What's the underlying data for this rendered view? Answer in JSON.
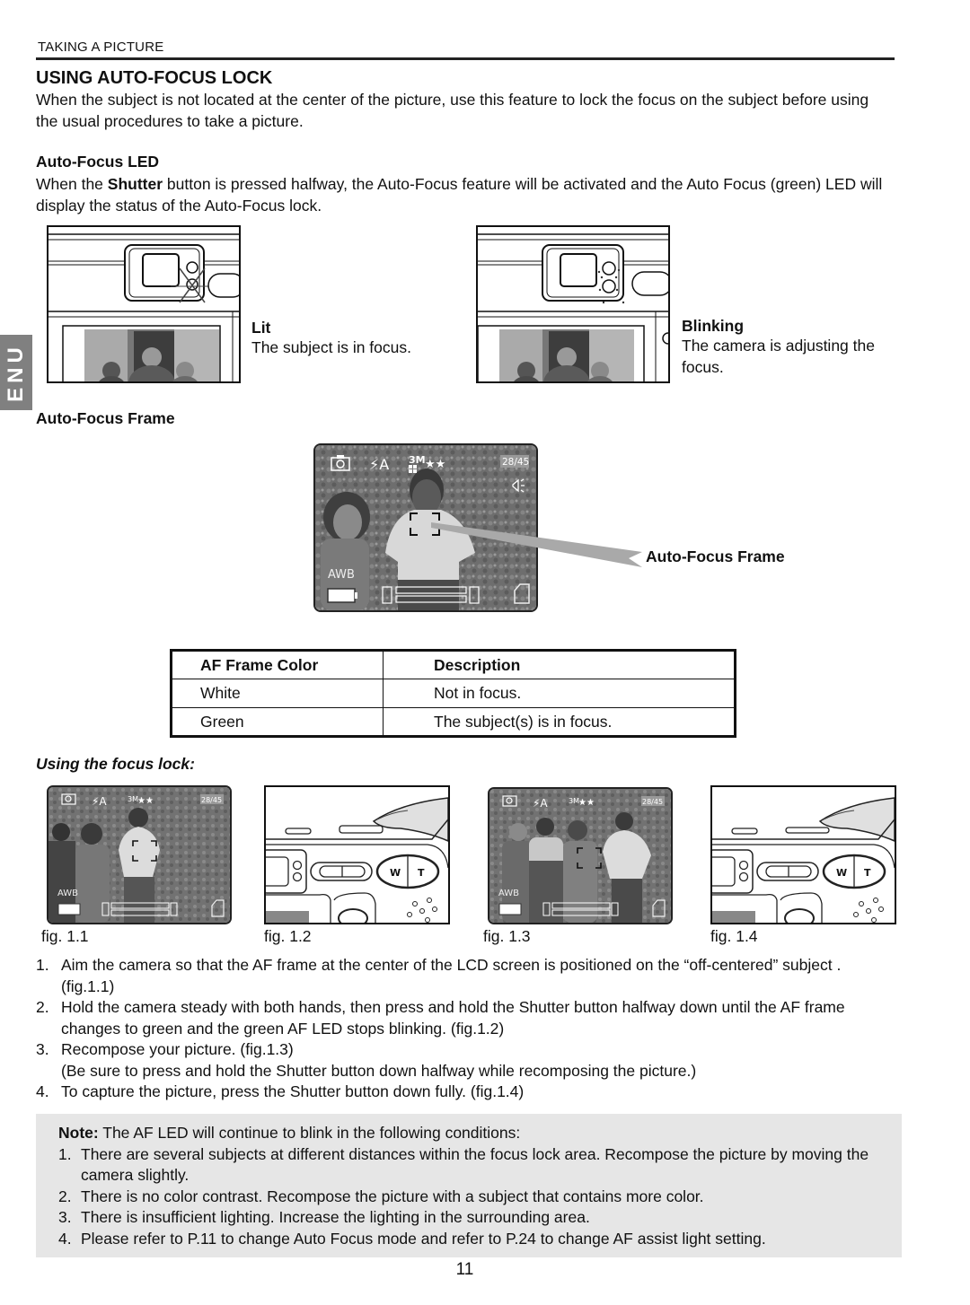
{
  "header": {
    "running_head": "TAKING A PICTURE"
  },
  "side_tab": {
    "label": "ENU"
  },
  "section": {
    "title": "USING AUTO-FOCUS LOCK",
    "intro": "When the subject is not located at the center of the picture, use this feature to lock the focus on the subject before using the usual procedures to take a picture."
  },
  "af_led": {
    "heading": "Auto-Focus LED",
    "text_before": "When the ",
    "text_bold": "Shutter",
    "text_after": " button is pressed halfway, the Auto-Focus feature will be activated and the Auto Focus (green) LED will display the status of the Auto-Focus lock.",
    "states": [
      {
        "title": "Lit",
        "description": "The subject is in focus."
      },
      {
        "title": "Blinking",
        "description": "The camera is adjusting the focus."
      }
    ]
  },
  "af_frame": {
    "heading": "Auto-Focus Frame",
    "callout_label": "Auto-Focus Frame",
    "lcd": {
      "shot_counter": "28/45",
      "resolution": "3M",
      "quality": "★★",
      "flash": "⚡A",
      "white_balance": "AWB",
      "icons": [
        "camera-mode-icon",
        "flash-auto-icon",
        "resolution-icon",
        "quality-icon",
        "shot-counter",
        "speaker-icon",
        "awb-icon",
        "battery-icon",
        "zoom-bar",
        "sd-card-icon"
      ]
    }
  },
  "af_table": {
    "headers": [
      "AF Frame Color",
      "Description"
    ],
    "rows": [
      [
        "White",
        "Not in focus."
      ],
      [
        "Green",
        "The subject(s) is in focus."
      ]
    ]
  },
  "focus_lock": {
    "heading": "Using the focus lock:",
    "figures": [
      {
        "caption": "fig. 1.1",
        "type": "lcd"
      },
      {
        "caption": "fig. 1.2",
        "type": "camera"
      },
      {
        "caption": "fig. 1.3",
        "type": "lcd"
      },
      {
        "caption": "fig. 1.4",
        "type": "camera"
      }
    ],
    "button_labels": {
      "wide": "W",
      "tele": "T"
    },
    "steps": [
      {
        "num": "1.",
        "text": "Aim the camera so that the AF frame at the center of the LCD screen is positioned on the “off-centered” subject . (fig.1.1)"
      },
      {
        "num": "2.",
        "text": "Hold the camera steady with both hands, then press and hold the Shutter button halfway down until the AF frame changes to green and the green AF LED stops blinking. (fig.1.2)"
      },
      {
        "num": "3.",
        "text": "Recompose your picture. (fig.1.3)",
        "sub": "(Be sure to press and hold the Shutter button down halfway while recomposing the picture.)"
      },
      {
        "num": "4.",
        "text": "To capture the picture, press the Shutter button down fully. (fig.1.4)"
      }
    ]
  },
  "note": {
    "label": "Note:",
    "intro": " The AF LED will continue to blink in the following conditions:",
    "items": [
      {
        "num": "1.",
        "text": "There are several subjects at different distances within the focus lock area. Recompose the picture by moving the camera slightly."
      },
      {
        "num": "2.",
        "text": "There is no color contrast. Recompose the picture with a subject that contains more color."
      },
      {
        "num": "3.",
        "text": "There is insufficient lighting. Increase the lighting in the surrounding area."
      },
      {
        "num": "4.",
        "text": "Please refer to P.11 to change Auto Focus mode and refer to P.24 to change AF assist light setting."
      }
    ]
  },
  "page_number": "11"
}
